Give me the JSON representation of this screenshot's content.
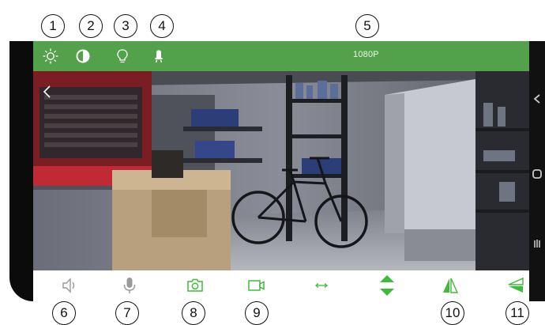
{
  "callouts": {
    "c1": "1",
    "c2": "2",
    "c3": "3",
    "c4": "4",
    "c5": "5",
    "c6": "6",
    "c7": "7",
    "c8": "8",
    "c9": "9",
    "c10": "10",
    "c11": "11"
  },
  "top_bar": {
    "resolution": "1080P",
    "icons": [
      "brightness-icon",
      "contrast-icon",
      "light-bulb-icon",
      "alarm-icon"
    ]
  },
  "bottom_bar": {
    "icons": [
      "speaker-icon",
      "microphone-icon",
      "camera-icon",
      "video-record-icon",
      "horizontal-pan-icon",
      "vertical-tilt-icon",
      "flip-vertical-icon",
      "flip-horizontal-icon"
    ]
  },
  "colors": {
    "accent": "#53a24b",
    "icon_active": "#3dbb3a",
    "icon_inactive": "#9a9a9a"
  }
}
